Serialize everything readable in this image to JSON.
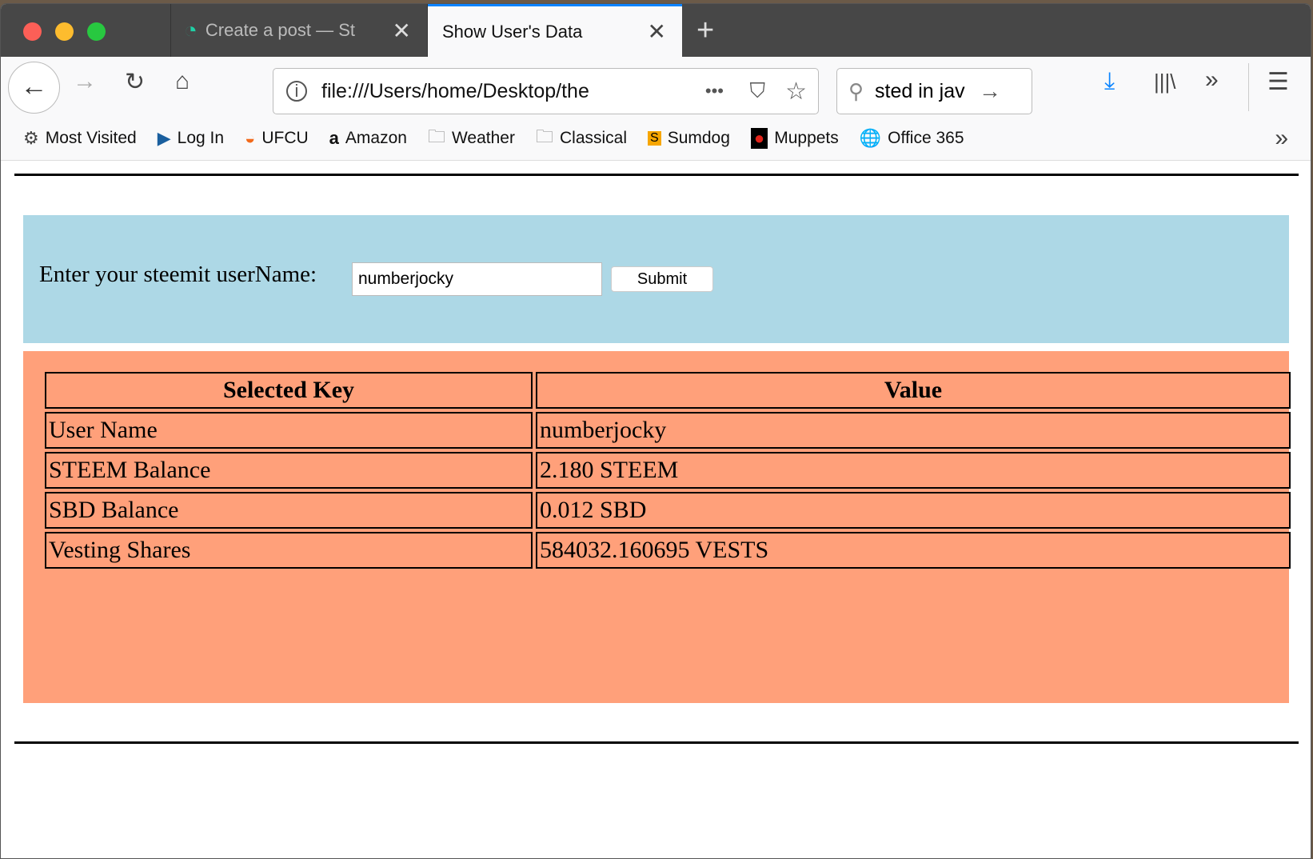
{
  "browser": {
    "tabs": [
      {
        "label": "Create a post — St",
        "active": false
      },
      {
        "label": "Show User's Data",
        "active": true
      }
    ],
    "url": "file:///Users/home/Desktop/the",
    "search_value": "sted in jav",
    "bookmarks": [
      {
        "label": "Most Visited",
        "icon": "gear-icon"
      },
      {
        "label": "Log In",
        "icon": "play-icon"
      },
      {
        "label": "UFCU",
        "icon": "ufcu-icon"
      },
      {
        "label": "Amazon",
        "icon": "amazon-icon"
      },
      {
        "label": "Weather",
        "icon": "folder-icon"
      },
      {
        "label": "Classical",
        "icon": "folder-icon"
      },
      {
        "label": "Sumdog",
        "icon": "sumdog-icon"
      },
      {
        "label": "Muppets",
        "icon": "elmo-icon"
      },
      {
        "label": "Office 365",
        "icon": "globe-icon"
      }
    ]
  },
  "form": {
    "label": "Enter your steemit userName:",
    "value": "numberjocky",
    "submit": "Submit"
  },
  "table": {
    "headers": [
      "Selected Key",
      "Value"
    ],
    "rows": [
      [
        "User Name",
        "numberjocky"
      ],
      [
        "STEEM Balance",
        "2.180 STEEM"
      ],
      [
        "SBD Balance",
        "0.012 SBD"
      ],
      [
        "Vesting Shares",
        "584032.160695 VESTS"
      ]
    ]
  },
  "colors": {
    "form_bg": "#add8e6",
    "table_bg": "#ffa07a",
    "accent": "#0a84ff"
  }
}
